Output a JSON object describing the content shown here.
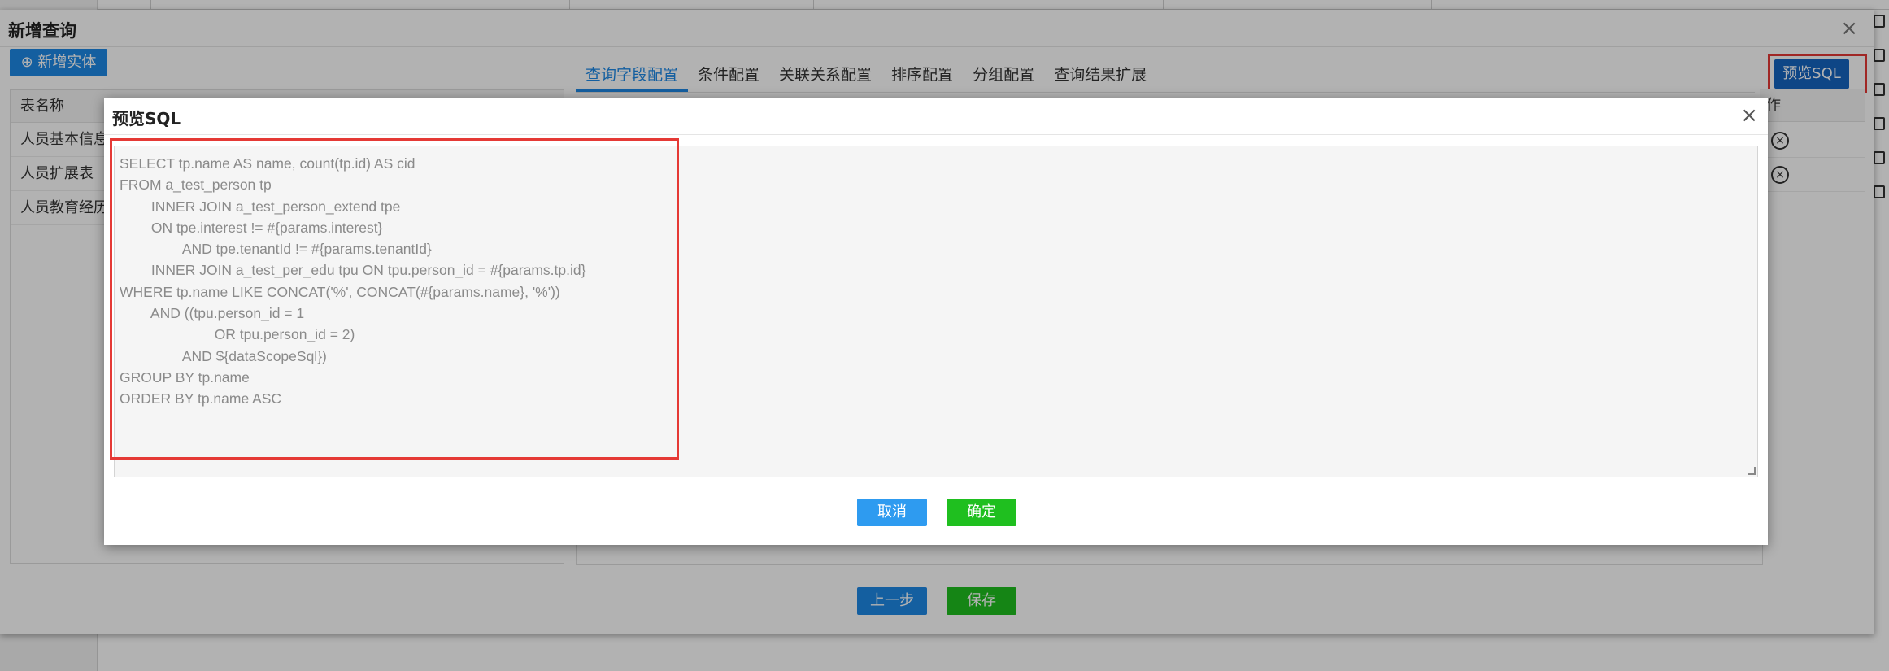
{
  "outer_dialog": {
    "title": "新增查询",
    "close_glyph": "×",
    "add_entity_label": "新增实体",
    "entity_table": {
      "header": "表名称",
      "rows": [
        "人员基本信息",
        "人员扩展表",
        "人员教育经历"
      ]
    },
    "tabs": [
      "查询字段配置",
      "条件配置",
      "关联关系配置",
      "排序配置",
      "分组配置",
      "查询结果扩展"
    ],
    "active_tab": "查询字段配置",
    "preview_sql_label": "预览SQL",
    "operation_header": "作",
    "prev_step_label": "上一步",
    "save_label": "保存"
  },
  "modal": {
    "title": "预览SQL",
    "close_glyph": "×",
    "sql_lines": [
      "SELECT tp.name AS name, count(tp.id) AS cid",
      "FROM a_test_person tp",
      "        INNER JOIN a_test_person_extend tpe",
      "        ON tpe.interest != #{params.interest}",
      "                AND tpe.tenantId != #{params.tenantId}",
      "        INNER JOIN a_test_per_edu tpu ON tpu.person_id = #{params.tp.id}",
      "WHERE tp.name LIKE CONCAT('%', CONCAT(#{params.name}, '%'))",
      "        AND ((tpu.person_id = 1",
      "                        OR tpu.person_id = 2)",
      "                AND ${dataScopeSql})",
      "GROUP BY tp.name",
      "ORDER BY tp.name ASC"
    ],
    "cancel_label": "取消",
    "confirm_label": "确定"
  },
  "colors": {
    "primary": "#1e88e5",
    "success": "#1fbf1f",
    "highlight": "#e53935"
  }
}
